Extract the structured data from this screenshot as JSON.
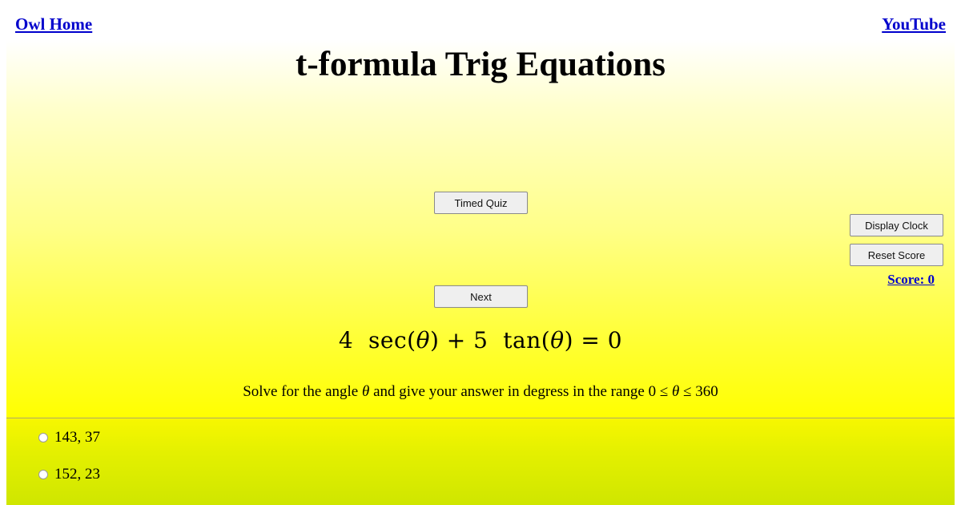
{
  "nav": {
    "home_label": "Owl Home",
    "youtube_label": "YouTube"
  },
  "header": {
    "title": "t-formula Trig Equations"
  },
  "controls": {
    "timed_quiz_label": "Timed Quiz",
    "next_label": "Next",
    "display_clock_label": "Display Clock",
    "reset_score_label": "Reset Score",
    "score_label": "Score: 0"
  },
  "question": {
    "equation_parts": {
      "coef1": "4",
      "func1": "sec",
      "var": "θ",
      "op": "+",
      "coef2": "5",
      "func2": "tan",
      "eq": "=",
      "rhs": "0"
    },
    "instruction_before": "Solve for the angle ",
    "instruction_var": "θ",
    "instruction_after": " and give your answer in degress in the range ",
    "range_low": "0",
    "range_le": "≤",
    "range_high": "360"
  },
  "options": [
    {
      "label": "143, 37",
      "selected": false
    },
    {
      "label": "152, 23",
      "selected": false
    }
  ],
  "colors": {
    "link": "#0000cc",
    "panel_bottom": "#ffff00",
    "answers_bottom": "#cfe600"
  }
}
